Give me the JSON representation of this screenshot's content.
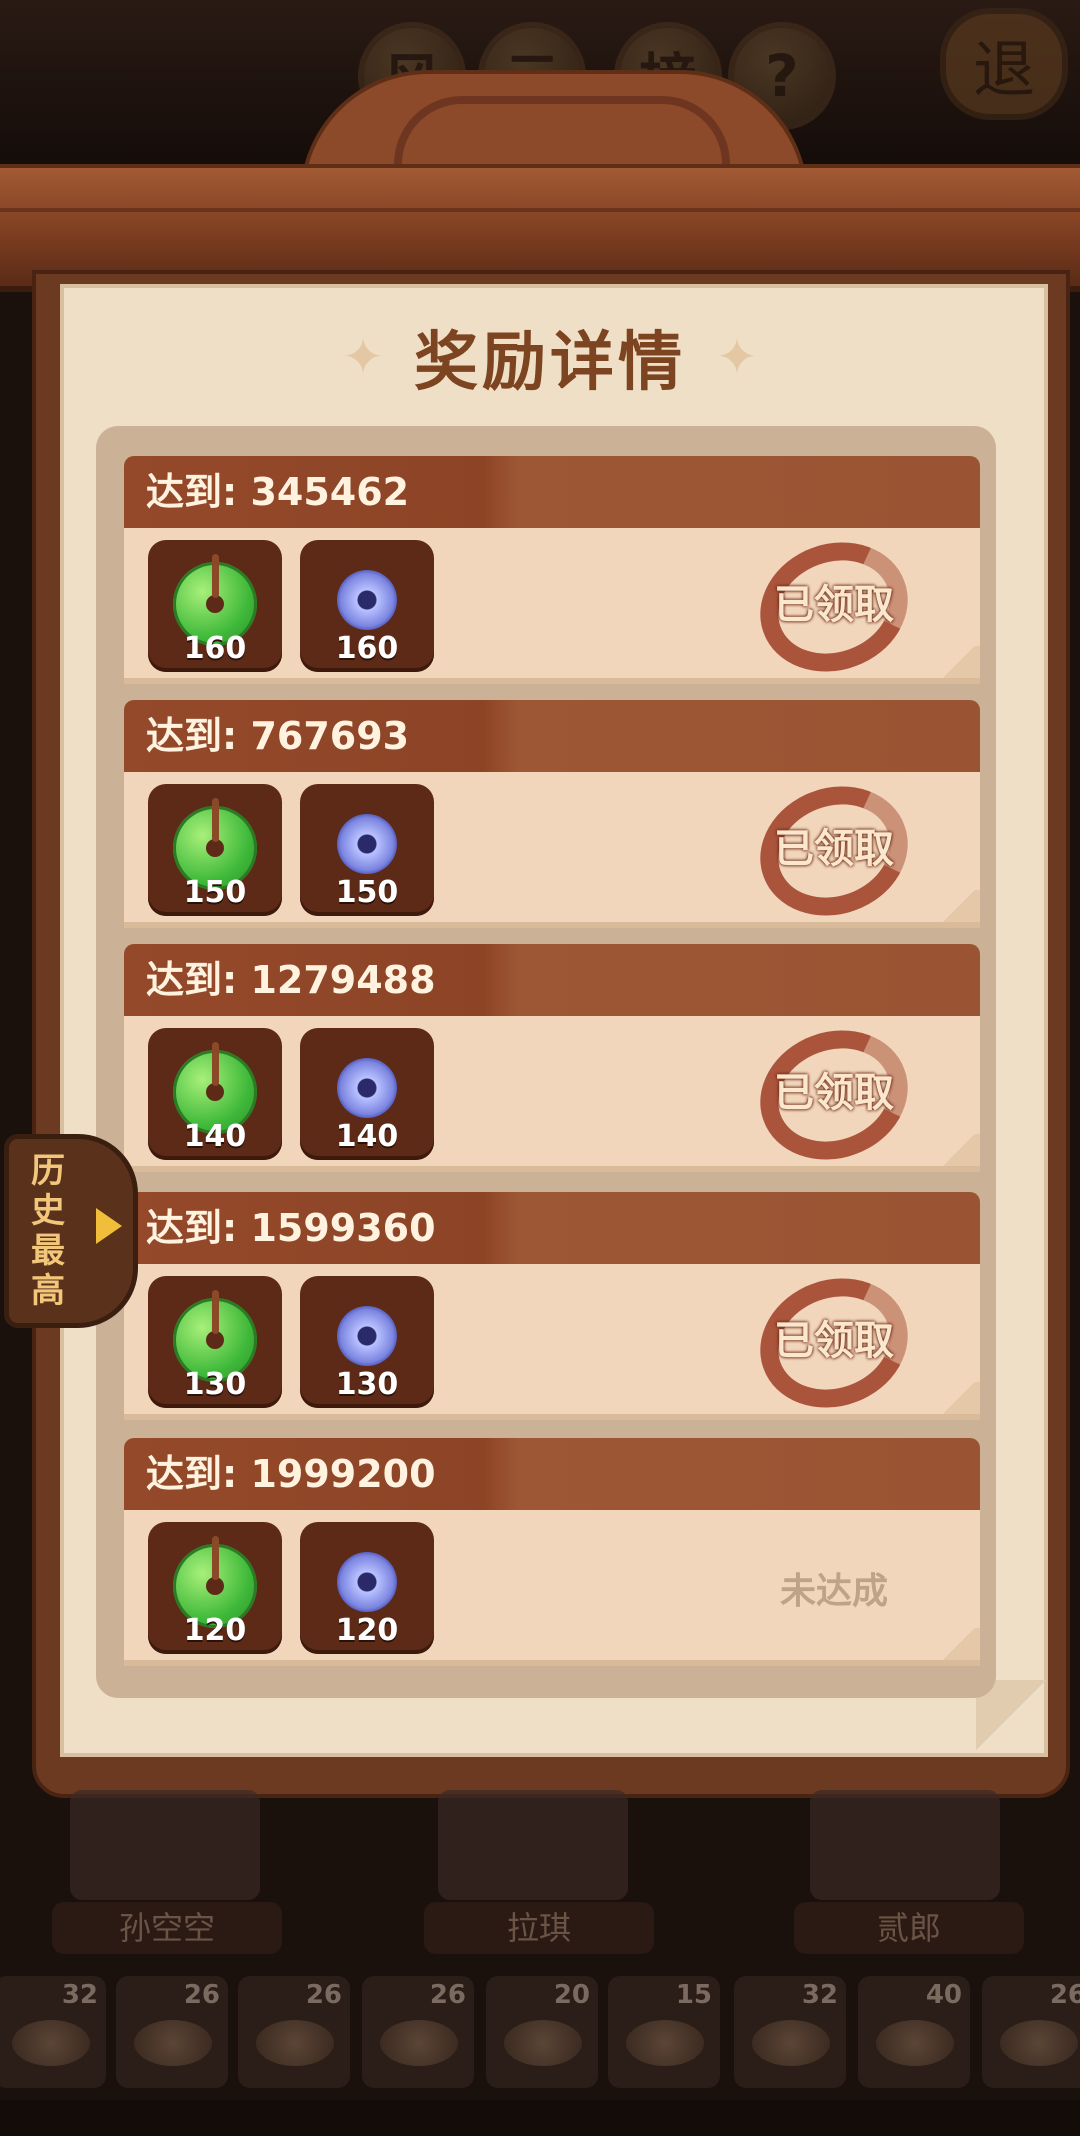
{
  "header": {
    "buttons": [
      "风",
      "云",
      "榜"
    ],
    "help_label": "?",
    "exit_label": "退"
  },
  "panel": {
    "title": "奖励详情"
  },
  "rewards": [
    {
      "target_prefix": "达到:",
      "target": "345462",
      "items": [
        {
          "icon": "green-jade-icon",
          "count": "160"
        },
        {
          "icon": "blue-ring-icon",
          "count": "160"
        }
      ],
      "status": "已领取",
      "claimed": true
    },
    {
      "target_prefix": "达到:",
      "target": "767693",
      "items": [
        {
          "icon": "green-jade-icon",
          "count": "150"
        },
        {
          "icon": "blue-ring-icon",
          "count": "150"
        }
      ],
      "status": "已领取",
      "claimed": true
    },
    {
      "target_prefix": "达到:",
      "target": "1279488",
      "items": [
        {
          "icon": "green-jade-icon",
          "count": "140"
        },
        {
          "icon": "blue-ring-icon",
          "count": "140"
        }
      ],
      "status": "已领取",
      "claimed": true
    },
    {
      "target_prefix": "达到:",
      "target": "1599360",
      "items": [
        {
          "icon": "green-jade-icon",
          "count": "130"
        },
        {
          "icon": "blue-ring-icon",
          "count": "130"
        }
      ],
      "status": "已领取",
      "claimed": true
    },
    {
      "target_prefix": "达到:",
      "target": "1999200",
      "items": [
        {
          "icon": "green-jade-icon",
          "count": "120"
        },
        {
          "icon": "blue-ring-icon",
          "count": "120"
        }
      ],
      "status": "未达成",
      "claimed": false
    }
  ],
  "history_tab": {
    "label": "历史最高"
  },
  "characters": [
    {
      "name": "孙空空"
    },
    {
      "name": "拉琪"
    },
    {
      "name": "贰郎"
    }
  ],
  "dishes": [
    "32",
    "26",
    "26",
    "26",
    "20",
    "15",
    "32",
    "40",
    "26"
  ],
  "colors": {
    "header_brown": "#8d4426",
    "paper": "#f0dfc7",
    "seal_red": "#9e3e26",
    "jade_green": "#3fb93a"
  }
}
